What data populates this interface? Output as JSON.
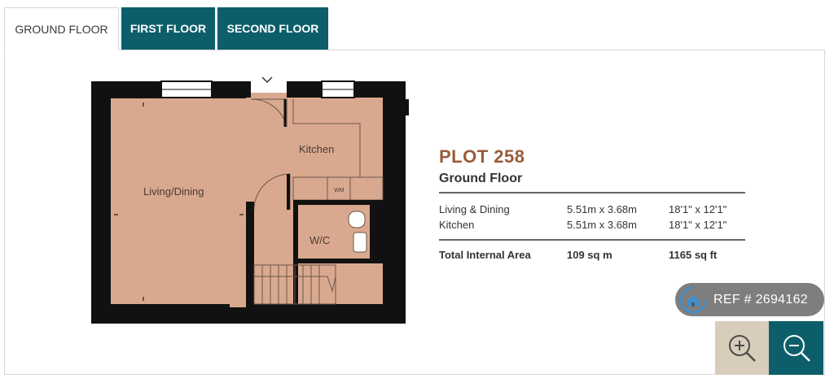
{
  "tabs": [
    {
      "label": "GROUND FLOOR",
      "active": true
    },
    {
      "label": "FIRST FLOOR",
      "active": false
    },
    {
      "label": "SECOND FLOOR",
      "active": false
    }
  ],
  "plan": {
    "rooms": {
      "living": "Living/Dining",
      "kitchen": "Kitchen",
      "wc": "W/C",
      "wm": "WM"
    },
    "colors": {
      "floor": "#d9a98f",
      "wall": "#111111"
    }
  },
  "info": {
    "plot": "PLOT 258",
    "floor": "Ground Floor",
    "rooms": [
      {
        "name": "Living & Dining",
        "metric": "5.51m x 3.68m",
        "imperial": "18'1\" x 12'1\""
      },
      {
        "name": "Kitchen",
        "metric": "5.51m x 3.68m",
        "imperial": "18'1\" x 12'1\""
      }
    ],
    "total": {
      "label": "Total Internal Area",
      "metric": "109 sq m",
      "imperial": "1165 sq ft"
    }
  },
  "ref": {
    "text": "REF # 2694162"
  },
  "controls": {
    "zoom_in_icon": "zoom-in-icon",
    "zoom_out_icon": "zoom-out-icon"
  },
  "colors": {
    "accent": "#0c5f6a",
    "plot_title": "#9a5c3c",
    "zoom_in_bg": "#d8cdbb"
  }
}
